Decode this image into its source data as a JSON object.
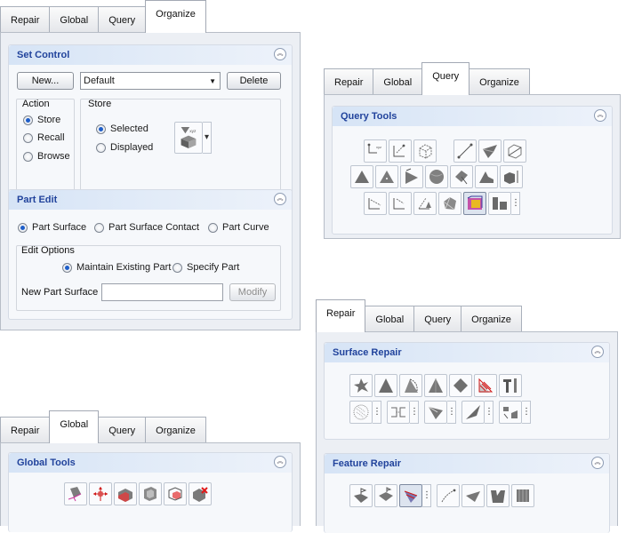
{
  "tabs": {
    "repair": "Repair",
    "global": "Global",
    "query": "Query",
    "organize": "Organize"
  },
  "organize_panel": {
    "set_control": {
      "title": "Set Control",
      "new_button": "New...",
      "set_combo_value": "Default",
      "delete_button": "Delete",
      "action_label": "Action",
      "action_options": [
        "Store",
        "Recall",
        "Browse"
      ],
      "action_selected": "Store",
      "store_label": "Store",
      "store_options": [
        "Selected",
        "Displayed"
      ],
      "store_selected": "Selected"
    },
    "part_edit": {
      "title": "Part Edit",
      "mode_options": [
        "Part Surface",
        "Part Surface Contact",
        "Part Curve"
      ],
      "mode_selected": "Part Surface",
      "edit_options_label": "Edit Options",
      "edit_options": [
        "Maintain Existing Part",
        "Specify Part"
      ],
      "edit_selected": "Maintain Existing Part",
      "new_part_surface_label": "New Part Surface",
      "new_part_surface_value": "",
      "modify_button": "Modify"
    }
  },
  "query_panel": {
    "group_title": "Query Tools",
    "tools": [
      "measure-distance-icon",
      "point-coordinates-icon",
      "cube-coordinate-icon",
      "line-length-icon",
      "surface-query-icon",
      "box-diagonal-icon",
      "triangle-area-icon",
      "triangle-normal-icon",
      "vector-angle-icon",
      "sphere-icon",
      "surface-normal-icon",
      "solid-corner-icon",
      "block-height-icon",
      "point-distance-icon",
      "curve-length-icon",
      "angle-query-icon",
      "mesh-query-icon",
      "bounding-box-icon",
      "part-spacing-icon"
    ]
  },
  "repair_panel": {
    "surface_repair_title": "Surface Repair",
    "surface_tools": [
      "star-patch-icon",
      "triangle-fill-icon",
      "arc-patch-icon",
      "triangle-repair-icon",
      "diamond-patch-icon",
      "red-hatch-icon",
      "wrench-icon",
      "dotted-circle-icon",
      "edge-bridge-icon",
      "fold-patch-icon",
      "split-sheet-icon",
      "fragment-icon"
    ],
    "feature_repair_title": "Feature Repair",
    "feature_tools": [
      "flag-surface-icon",
      "flag-patch-icon",
      "cone-feature-icon",
      "curve-feature-icon",
      "wing-feature-icon",
      "block-feature-icon",
      "stamp-feature-icon"
    ]
  },
  "global_panel": {
    "group_title": "Global Tools",
    "tools": [
      "surface-connect-icon",
      "translate-icon",
      "solid-section-icon",
      "shell-icon",
      "cube-subtract-icon",
      "remove-solid-icon"
    ]
  },
  "colors": {
    "group_title": "#21439c",
    "group_header": "#d6e4f6",
    "panel_bg": "#eceff4",
    "radio_dot": "#1e5ec9"
  }
}
